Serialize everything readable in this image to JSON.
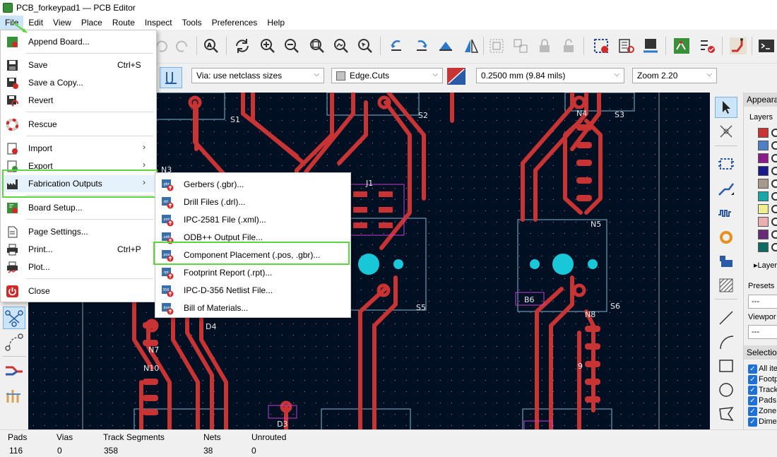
{
  "window": {
    "title": "PCB_forkeypad1 — PCB Editor"
  },
  "menubar": {
    "items": [
      "File",
      "Edit",
      "View",
      "Place",
      "Route",
      "Inspect",
      "Tools",
      "Preferences",
      "Help"
    ]
  },
  "toolbar2": {
    "via_size": "Via: use netclass sizes",
    "layer": "Edge.Cuts",
    "track_width": "0.2500 mm (9.84 mils)",
    "zoom": "Zoom 2.20"
  },
  "file_menu": {
    "items": [
      {
        "label": "Append Board...",
        "shortcut": ""
      },
      {
        "label": "Save",
        "shortcut": "Ctrl+S"
      },
      {
        "label": "Save a Copy...",
        "shortcut": ""
      },
      {
        "label": "Revert",
        "shortcut": ""
      },
      {
        "label": "Rescue",
        "shortcut": ""
      },
      {
        "label": "Import",
        "shortcut": ""
      },
      {
        "label": "Export",
        "shortcut": ""
      },
      {
        "label": "Fabrication Outputs",
        "shortcut": ""
      },
      {
        "label": "Board Setup...",
        "shortcut": ""
      },
      {
        "label": "Page Settings...",
        "shortcut": ""
      },
      {
        "label": "Print...",
        "shortcut": "Ctrl+P"
      },
      {
        "label": "Plot...",
        "shortcut": ""
      },
      {
        "label": "Close",
        "shortcut": ""
      }
    ]
  },
  "fab_submenu": {
    "items": [
      {
        "label": "Gerbers (.gbr)...",
        "tag": ".gbr"
      },
      {
        "label": "Drill Files (.drl)...",
        "tag": ".drl"
      },
      {
        "label": "IPC-2581 File (.xml)...",
        "tag": ".xml"
      },
      {
        "label": "ODB++ Output File...",
        "tag": ".odb"
      },
      {
        "label": "Component Placement (.pos, .gbr)...",
        "tag": ".pos"
      },
      {
        "label": "Footprint Report (.rpt)...",
        "tag": ".rpt"
      },
      {
        "label": "IPC-D-356 Netlist File...",
        "tag": "356"
      },
      {
        "label": "Bill of Materials...",
        "tag": ".bom"
      }
    ]
  },
  "right_panel": {
    "appearance_title": "Appeara",
    "layers_tab": "Layers",
    "layer_colors": [
      "#c83434",
      "#4d7fc4",
      "#8b1a8b",
      "#1a1a8b",
      "#a89a8a",
      "#18a8a8",
      "#f0ee90",
      "#e8b0b0",
      "#6a2a7a",
      "#0e6a62"
    ],
    "layers_expander": "Layer",
    "presets_label": "Presets",
    "presets_value": "---",
    "viewport_label": "Viewpor",
    "viewport_value": "---",
    "selection_title": "Selection",
    "selection_items": [
      "All ite",
      "Footp",
      "Track",
      "Pads",
      "Zone",
      "Dime"
    ]
  },
  "canvas_labels": {
    "refs": [
      "S1",
      "S2",
      "S3",
      "N4",
      "N3",
      "J1",
      "N5",
      "B6",
      "S5",
      "S6",
      "D4",
      "N7",
      "N8",
      "N10",
      "9",
      "D3"
    ]
  },
  "statusbar": {
    "items": [
      {
        "label": "Pads",
        "value": "116"
      },
      {
        "label": "Vias",
        "value": "0"
      },
      {
        "label": "Track Segments",
        "value": "358"
      },
      {
        "label": "Nets",
        "value": "38"
      },
      {
        "label": "Unrouted",
        "value": "0"
      }
    ]
  },
  "colors": {
    "canvas_bg": "#001023",
    "track": "#c83434",
    "pad": "#c83434",
    "hole": "#18c8d8",
    "courtyard": "#7fb6d0",
    "silk_ref": "#e8e8e8",
    "highlight": "#5bd63c"
  }
}
